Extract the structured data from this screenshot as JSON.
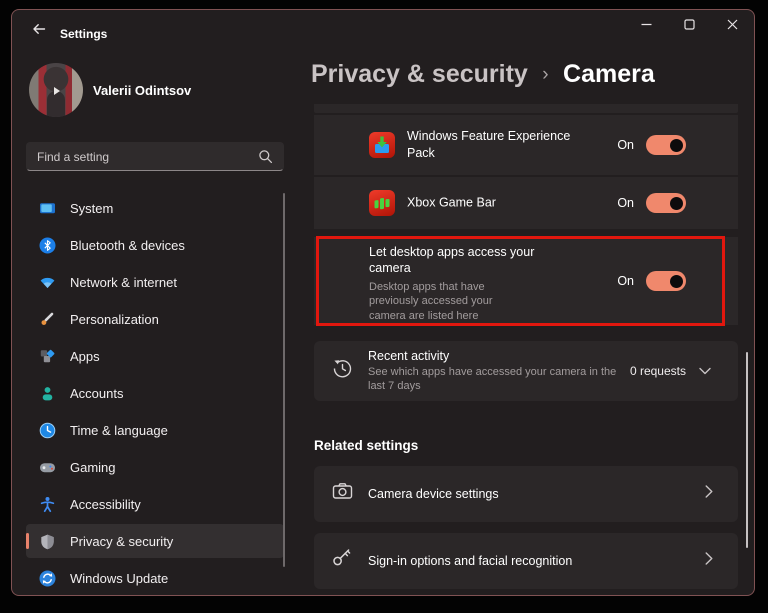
{
  "colors": {
    "toggle_accent": "#f0886c",
    "highlight_border": "#e1170e",
    "nav_selection_accent": "#e8826b",
    "window_background": "#221e1f",
    "card_background": "#2b2728"
  },
  "window": {
    "title": "Settings"
  },
  "user": {
    "name": "Valerii Odintsov"
  },
  "sidebar": {
    "search_placeholder": "Find a setting",
    "items": [
      {
        "label": "System",
        "icon": "system-icon"
      },
      {
        "label": "Bluetooth & devices",
        "icon": "bluetooth-icon"
      },
      {
        "label": "Network & internet",
        "icon": "network-icon"
      },
      {
        "label": "Personalization",
        "icon": "personalization-icon"
      },
      {
        "label": "Apps",
        "icon": "apps-icon"
      },
      {
        "label": "Accounts",
        "icon": "accounts-icon"
      },
      {
        "label": "Time & language",
        "icon": "time-language-icon"
      },
      {
        "label": "Gaming",
        "icon": "gaming-icon"
      },
      {
        "label": "Accessibility",
        "icon": "accessibility-icon"
      },
      {
        "label": "Privacy & security",
        "icon": "privacy-security-icon",
        "selected": true
      },
      {
        "label": "Windows Update",
        "icon": "windows-update-icon"
      }
    ]
  },
  "header": {
    "parent": "Privacy & security",
    "separator": "›",
    "current": "Camera"
  },
  "content": {
    "app_rows": [
      {
        "title": "Windows Feature Experience Pack",
        "toggle": "On",
        "state": true
      },
      {
        "title": "Xbox Game Bar",
        "toggle": "On",
        "state": true
      }
    ],
    "desktop_apps_row": {
      "title": "Let desktop apps access your camera",
      "description": "Desktop apps that have previously accessed your camera are listed here",
      "toggle": "On",
      "state": true,
      "highlighted": true
    },
    "recent_activity": {
      "title": "Recent activity",
      "description": "See which apps have accessed your camera in the last 7 days",
      "value": "0 requests"
    },
    "related": {
      "heading": "Related settings",
      "links": [
        {
          "label": "Camera device settings",
          "icon": "camera-icon"
        },
        {
          "label": "Sign-in options and facial recognition",
          "icon": "key-icon"
        }
      ]
    }
  }
}
